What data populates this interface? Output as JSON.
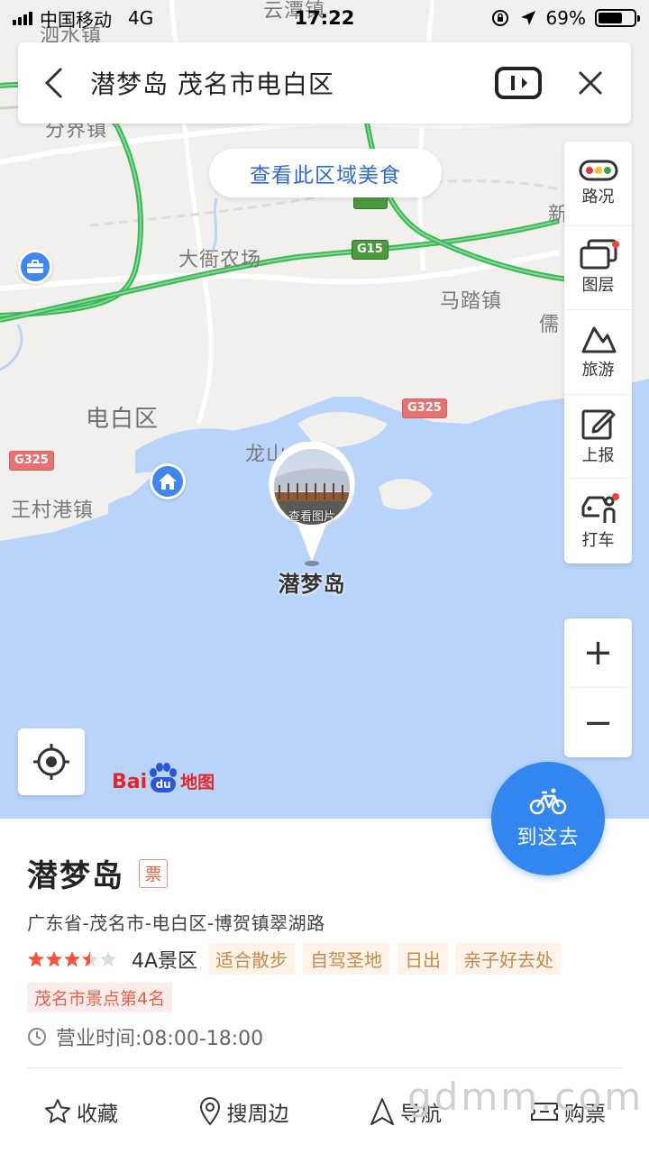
{
  "status_bar": {
    "carrier": "中国移动",
    "network": "4G",
    "time": "17:22",
    "battery": "69%",
    "battery_level": 0.69
  },
  "search": {
    "query": "潜梦岛 茂名市电白区"
  },
  "map": {
    "food_button": "查看此区域美食",
    "labels": {
      "top_town_1": "云潭镇",
      "top_town_2": "泗水镇",
      "top_town_3": "分界镇",
      "farm": "大衙农场",
      "town_mata": "马踏镇",
      "town_ru": "儒",
      "town_xin": "新",
      "district": "电白区",
      "town_wangcun": "王村港镇",
      "town_longshan": "龙山",
      "pin_name": "潜梦岛",
      "pin_photo": "查看图片"
    },
    "road_badges": {
      "g15": "G15",
      "g325_a": "G325",
      "g325_b": "G325"
    },
    "colors": {
      "sea": "#b9d4fb",
      "land": "#f1f0ec",
      "highway": "#4cc66a",
      "accent": "#3385f0"
    }
  },
  "tools": {
    "traffic": "路况",
    "layers": "图层",
    "travel": "旅游",
    "report": "上报",
    "taxi": "打车"
  },
  "zoom": {
    "in": "+",
    "out": "−"
  },
  "logo": {
    "bai": "Bai",
    "du": "du",
    "ditu": "地图"
  },
  "go": {
    "label": "到这去"
  },
  "place": {
    "name": "潜梦岛",
    "ticket": "票",
    "address": "广东省-茂名市-电白区-博贺镇翠湖路",
    "stars": 3.5,
    "level": "4A景区",
    "tags": [
      "适合散步",
      "自驾圣地",
      "日出",
      "亲子好去处"
    ],
    "rank": "茂名市景点第4名",
    "hours": "营业时间:08:00-18:00"
  },
  "actions": {
    "favorite": "收藏",
    "nearby": "搜周边",
    "navigate": "导航",
    "buy_ticket": "购票"
  },
  "watermark": "gdmm.com"
}
